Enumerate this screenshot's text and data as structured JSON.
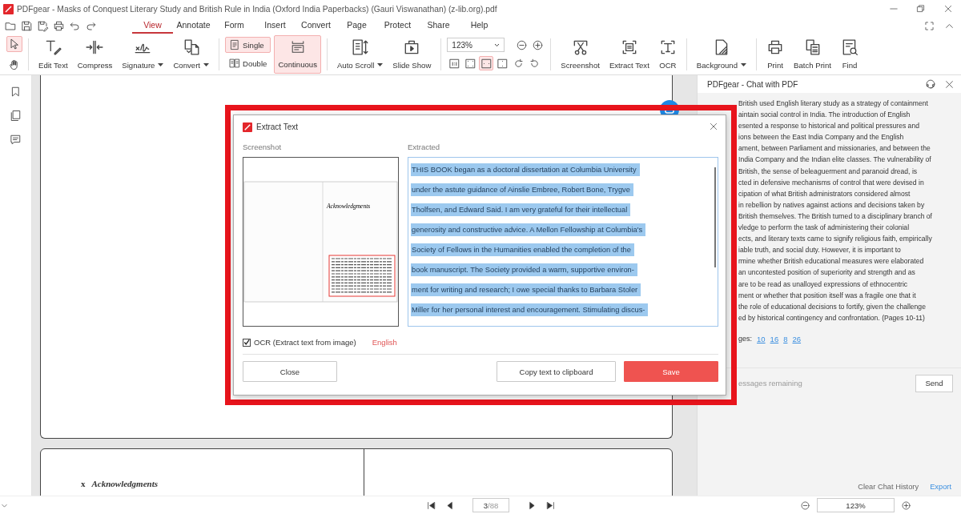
{
  "window": {
    "title": "PDFgear - Masks of Conquest Literary Study and British Rule in India (Oxford India Paperbacks) (Gauri Viswanathan) (z-lib.org).pdf"
  },
  "menu_tabs": [
    {
      "label": "View",
      "selected": true
    },
    {
      "label": "Annotate",
      "selected": false
    },
    {
      "label": "Form",
      "selected": false
    },
    {
      "label": "Insert",
      "selected": false
    },
    {
      "label": "Convert",
      "selected": false
    },
    {
      "label": "Page",
      "selected": false
    },
    {
      "label": "Protect",
      "selected": false
    },
    {
      "label": "Share",
      "selected": false
    },
    {
      "label": "Help",
      "selected": false
    }
  ],
  "ribbon": {
    "groups": [
      {
        "kind": "tools",
        "buttons": [
          {
            "kind": "select",
            "selected": true
          },
          {
            "kind": "hand",
            "selected": false
          }
        ]
      },
      {
        "kind": "large",
        "buttons": [
          {
            "kind": "edit_text",
            "label": "Edit Text",
            "dropdown": false
          },
          {
            "kind": "compress",
            "label": "Compress",
            "dropdown": false
          },
          {
            "kind": "signature",
            "label": "Signature",
            "dropdown": true
          },
          {
            "kind": "convert",
            "label": "Convert",
            "dropdown": true
          }
        ]
      },
      {
        "kind": "view_mode",
        "buttons": [
          {
            "kind": "single",
            "label": "Single",
            "selected": true
          },
          {
            "kind": "double",
            "label": "Double",
            "selected": false
          },
          {
            "kind": "continuous",
            "label": "Continuous",
            "selected": true
          }
        ]
      },
      {
        "kind": "large",
        "buttons": [
          {
            "kind": "auto_scroll",
            "label": "Auto Scroll",
            "dropdown": true
          },
          {
            "kind": "slide_show",
            "label": "Slide Show",
            "dropdown": false
          }
        ]
      },
      {
        "kind": "zoom",
        "value": "123%",
        "buttons": [
          {
            "kind": "zoom_out",
            "selected": false
          },
          {
            "kind": "zoom_in",
            "selected": false
          },
          {
            "kind": "actual_size",
            "selected": false
          },
          {
            "kind": "fit_page",
            "selected": false
          },
          {
            "kind": "fit_width",
            "selected": true
          },
          {
            "kind": "fit_height",
            "selected": false
          },
          {
            "kind": "rotate_cw",
            "selected": false
          },
          {
            "kind": "rotate_ccw",
            "selected": false
          }
        ]
      },
      {
        "kind": "large",
        "buttons": [
          {
            "kind": "screenshot",
            "label": "Screenshot",
            "dropdown": false
          },
          {
            "kind": "extract_text",
            "label": "Extract Text",
            "dropdown": false
          },
          {
            "kind": "ocr",
            "label": "OCR",
            "dropdown": false
          }
        ]
      },
      {
        "kind": "large",
        "buttons": [
          {
            "kind": "background",
            "label": "Background",
            "dropdown": true
          }
        ]
      },
      {
        "kind": "large",
        "buttons": [
          {
            "kind": "print",
            "label": "Print",
            "dropdown": false
          },
          {
            "kind": "batch_print",
            "label": "Batch Print",
            "dropdown": false
          },
          {
            "kind": "find",
            "label": "Find",
            "dropdown": false
          }
        ]
      }
    ]
  },
  "document": {
    "folio": "x",
    "heading": "Acknowledgments"
  },
  "dialog": {
    "title": "Extract Text",
    "screenshot_label": "Screenshot",
    "preview_heading": "Acknowledgments",
    "extracted_label": "Extracted",
    "extracted_lines": [
      "THIS BOOK began as a doctoral dissertation at Columbia University",
      "under the astute guidance of Ainslie Embree, Robert Bone, Trygve",
      "Tholfsen, and Edward Said. I am very grateful for their intellectual",
      "generosity and constructive advice. A Mellon Fellowship at Columbia's",
      "Society of Fellows in the Humanities enabled the completion of the",
      "book manuscript. The Society provided a warm, supportive environ-",
      "ment for writing and research; I owe special thanks to Barbara Stoler",
      "Miller for her personal interest and encouragement. Stimulating discus-"
    ],
    "ocr": {
      "label": "OCR (Extract text from image)",
      "checked": true
    },
    "language": "English",
    "buttons": [
      {
        "kind": "secondary",
        "label": "Close"
      },
      {
        "kind": "secondary",
        "label": "Copy text to clipboard"
      },
      {
        "kind": "primary",
        "label": "Save"
      }
    ]
  },
  "chat": {
    "title": "PDFgear - Chat with PDF",
    "answer_lines": [
      "British used English literary study as a strategy of containment",
      "aintain social control in India. The introduction of English",
      "esented a response to historical and political pressures and",
      "ions between the East India Company and the English",
      "ament, between Parliament and missionaries, and between the",
      "India Company and the Indian elite classes. The vulnerability of",
      "British, the sense of beleaguerment and paranoid dread, is",
      "cted in defensive mechanisms of control that were devised in",
      "cipation of what British administrators considered almost",
      "in rebellion by natives against actions and decisions taken by",
      "British themselves. The British turned to a disciplinary branch of",
      "vledge to perform the task of administering their colonial",
      "ects, and literary texts came to signify religious faith, empirically",
      "iable truth, and social duty. However, it is important to",
      "rmine whether British educational measures were elaborated",
      "an uncontested position of superiority and strength and as",
      "are to be read as unalloyed expressions of ethnocentric",
      "ment or whether that position itself was a fragile one that it",
      "the role of educational decisions to fortify, given the challenge",
      "ed by historical contingency and confrontation. (Pages 10-11)"
    ],
    "pages_label": "ges:",
    "page_links": [
      "10",
      "16",
      "8",
      "26"
    ],
    "status": "essages remaining",
    "send": "Send",
    "clear": "Clear Chat History",
    "export": "Export"
  },
  "status_bar": {
    "page": "3",
    "page_total": "/88",
    "zoom": "123%"
  }
}
